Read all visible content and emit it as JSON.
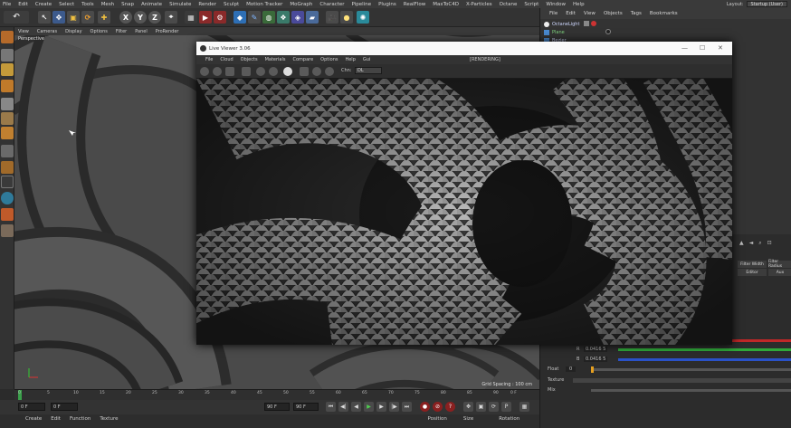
{
  "app": {
    "menu": [
      "File",
      "Edit",
      "Create",
      "Select",
      "Tools",
      "Mesh",
      "Snap",
      "Animate",
      "Simulate",
      "Render",
      "Sculpt",
      "Motion Tracker",
      "MoGraph",
      "Character",
      "Pipeline",
      "Plugins",
      "RealFlow",
      "MaxToC4D",
      "X-Particles",
      "Octane",
      "Script",
      "Window",
      "Help"
    ],
    "layout_label": "Layout:",
    "layout_value": "Startup (User)"
  },
  "toolbar": {
    "axis_x": "X",
    "axis_y": "Y",
    "axis_z": "Z"
  },
  "viewport": {
    "menu": [
      "View",
      "Cameras",
      "Display",
      "Options",
      "Filter",
      "Panel",
      "ProRender"
    ],
    "label": "Perspective",
    "grid_spacing": "Grid Spacing : 100 cm"
  },
  "timeline": {
    "ticks": [
      "0",
      "5",
      "10",
      "15",
      "20",
      "25",
      "30",
      "35",
      "40",
      "45",
      "50",
      "55",
      "60",
      "65",
      "70",
      "75",
      "80",
      "85",
      "90"
    ],
    "end_frame": "0 F",
    "start_field": "0 F",
    "min_field": "0 F",
    "max_field": "90 F",
    "end_field": "90 F"
  },
  "bottom_menu": [
    "Create",
    "Edit",
    "Function",
    "Texture"
  ],
  "bottom_fields": [
    "Position",
    "Size",
    "Rotation"
  ],
  "object_manager": {
    "menu": [
      "File",
      "Edit",
      "View",
      "Objects",
      "Tags",
      "Bookmarks"
    ],
    "objects": [
      {
        "name": "OctaneLight"
      },
      {
        "name": "Plane"
      },
      {
        "name": "Bezier"
      }
    ]
  },
  "attributes": {
    "tabs": [
      "Filter Width",
      "Filter Radius"
    ],
    "tab2": [
      "Editor",
      "Aux"
    ],
    "rows": [
      {
        "label": "R",
        "value": "0.0416 5"
      },
      {
        "label": "B",
        "value": "0.0416 5"
      },
      {
        "label": "Float",
        "value": "0"
      },
      {
        "label": "Texture",
        "value": ""
      },
      {
        "label": "Mix",
        "value": ""
      }
    ],
    "colors": {
      "red": "#c02828",
      "green": "#2fa83a",
      "blue": "#2a52c8"
    }
  },
  "live_viewer": {
    "title": "Live Viewer 3.06",
    "menu": [
      "File",
      "Cloud",
      "Objects",
      "Materials",
      "Compare",
      "Options",
      "Help",
      "Gui"
    ],
    "status": "[RENDERING]",
    "channel_label": "Chn:",
    "channel_value": "DL"
  }
}
